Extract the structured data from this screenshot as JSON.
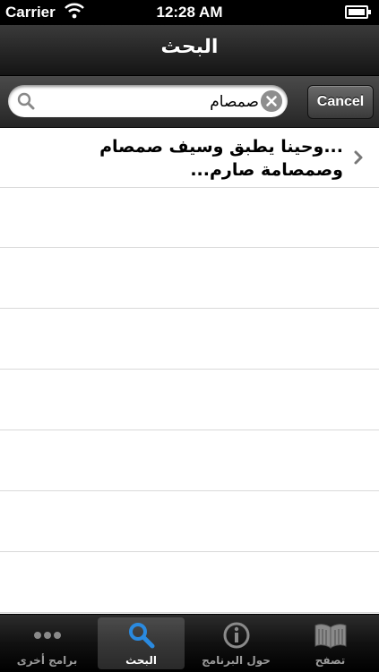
{
  "status_bar": {
    "carrier": "Carrier",
    "time": "12:28 AM"
  },
  "nav_bar": {
    "title": "البحث"
  },
  "search": {
    "query": "صمصام",
    "cancel_label": "Cancel"
  },
  "results": [
    {
      "text": "...وحينا يطبق وسيف  صمصام وصمصامة صارم..."
    }
  ],
  "tab_bar": {
    "tabs": [
      {
        "label": "برامج أخرى",
        "icon": "more-dots-icon",
        "selected": false
      },
      {
        "label": "حول البرنامج",
        "icon": "info-icon",
        "selected": false
      },
      {
        "label": "البحث",
        "icon": "search-icon",
        "selected": true
      },
      {
        "label": "تصفح",
        "icon": "book-icon",
        "selected": false
      }
    ]
  },
  "colors": {
    "tab_selected_icon": "#2a8ae0",
    "tab_inactive_icon": "#8a8a8a"
  }
}
